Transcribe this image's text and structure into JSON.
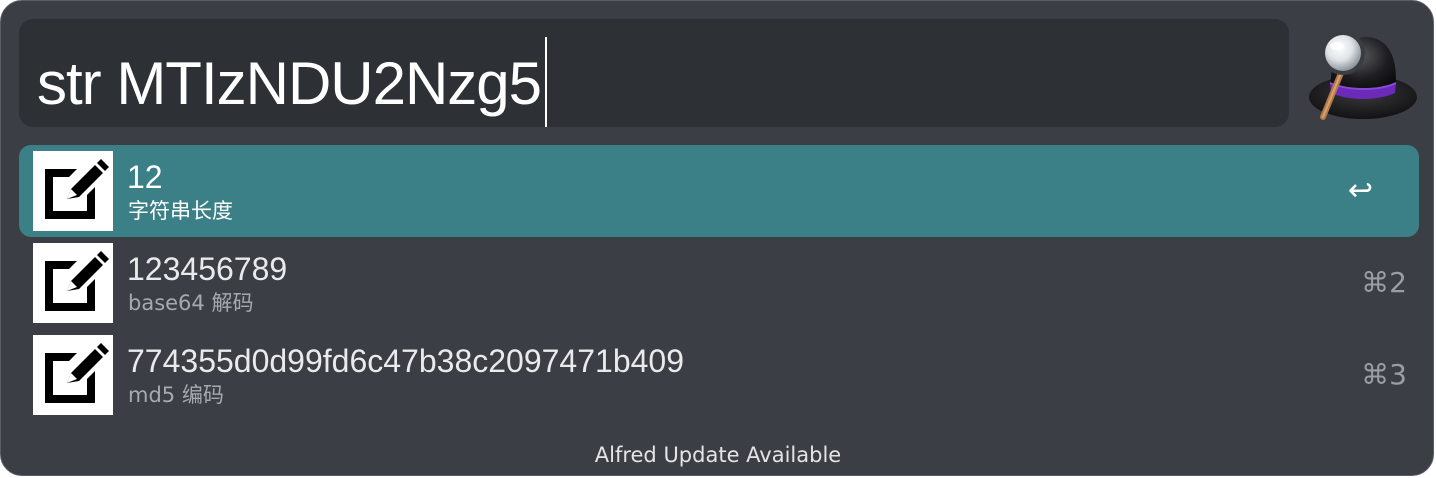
{
  "search": {
    "query": "str MTIzNDU2Nzg5"
  },
  "app": {
    "logo_icon": "alfred-hat-icon"
  },
  "results": [
    {
      "title": "12",
      "subtitle": "字符串长度",
      "shortcut": "↩",
      "icon": "edit-note-icon",
      "selected": true
    },
    {
      "title": "123456789",
      "subtitle": "base64 解码",
      "shortcut": "⌘2",
      "icon": "edit-note-icon",
      "selected": false
    },
    {
      "title": "774355d0d99fd6c47b38c2097471b409",
      "subtitle": "md5 编码",
      "shortcut": "⌘3",
      "icon": "edit-note-icon",
      "selected": false
    }
  ],
  "footer": {
    "text": "Alfred Update Available"
  },
  "colors": {
    "window_bg": "#3b3e44",
    "search_bg": "#2d3035",
    "selected_row": "#3a8086",
    "text_primary": "#ffffff",
    "text_secondary": "#a6a9ae"
  }
}
